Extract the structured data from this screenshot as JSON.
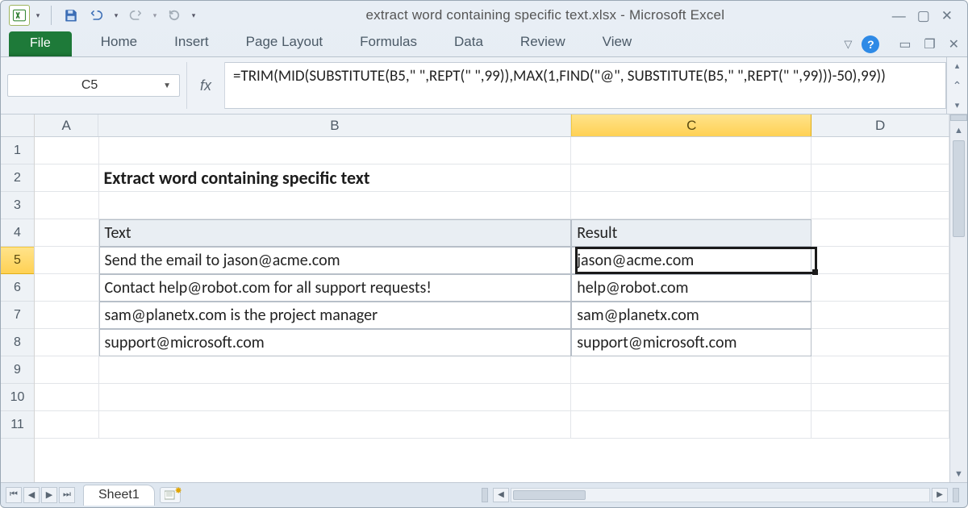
{
  "title": "extract word containing specific text.xlsx  -  Microsoft Excel",
  "tabs": {
    "file": "File",
    "items": [
      "Home",
      "Insert",
      "Page Layout",
      "Formulas",
      "Data",
      "Review",
      "View"
    ]
  },
  "help": "?",
  "namebox": "C5",
  "fx_label": "fx",
  "formula": "=TRIM(MID(SUBSTITUTE(B5,\" \",REPT(\" \",99)),MAX(1,FIND(\"@\", SUBSTITUTE(B5,\" \",REPT(\" \",99)))-50),99))",
  "col_headers": [
    "A",
    "B",
    "C",
    "D"
  ],
  "row_headers": [
    "1",
    "2",
    "3",
    "4",
    "5",
    "6",
    "7",
    "8",
    "9",
    "10",
    "11"
  ],
  "active_row": "5",
  "active_col": "C",
  "content": {
    "title_cell": "Extract word containing specific text",
    "header_text": "Text",
    "header_result": "Result",
    "rows": [
      {
        "text": "Send the email to jason@acme.com",
        "result": "jason@acme.com"
      },
      {
        "text": "Contact help@robot.com for all support requests!",
        "result": "help@robot.com"
      },
      {
        "text": "sam@planetx.com is the project manager",
        "result": "sam@planetx.com"
      },
      {
        "text": "support@microsoft.com",
        "result": "support@microsoft.com"
      }
    ]
  },
  "sheet_name": "Sheet1"
}
